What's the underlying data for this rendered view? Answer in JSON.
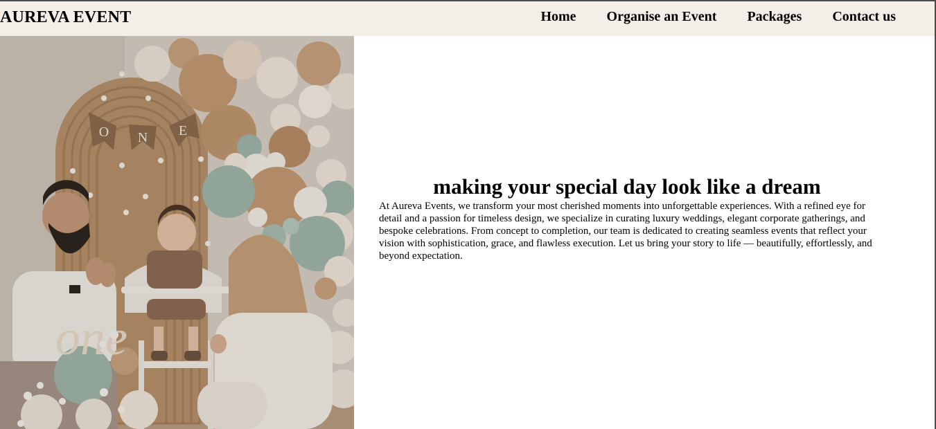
{
  "header": {
    "brand": "AUREVA EVENT",
    "nav": [
      {
        "label": "Home"
      },
      {
        "label": "Organise an Event"
      },
      {
        "label": "Packages"
      },
      {
        "label": "Contact us"
      }
    ]
  },
  "hero": {
    "image_alt": "Family celebrating a baby's first birthday with a balloon arch",
    "banner_letters": [
      "O",
      "N",
      "E"
    ],
    "cake_topper": "one",
    "headline": "making your special day look like a dream",
    "description": "At Aureva Events, we transform your most cherished moments into unforgettable experiences. With a refined eye for detail and a passion for timeless design, we specialize in curating luxury weddings, elegant corporate gatherings, and bespoke celebrations. From concept to completion, our team is dedicated to creating seamless events that reflect your vision with sophistication, grace, and flawless execution. Let us bring your story to life — beautifully, effortlessly, and beyond expectation."
  },
  "colors": {
    "header_bg": "#f3eee7",
    "page_bg": "#ffffff",
    "text": "#000000",
    "balloon_tan": "#c9a27f",
    "balloon_sage": "#9fb7ac",
    "balloon_cream": "#f2e8dd"
  }
}
